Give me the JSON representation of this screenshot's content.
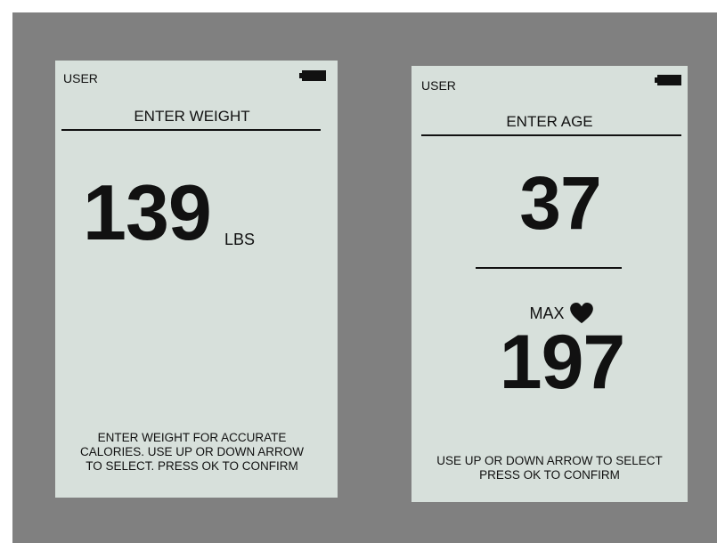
{
  "weight_screen": {
    "user": "USER",
    "title": "ENTER WEIGHT",
    "value": "139",
    "unit": "LBS",
    "instructions_line1": "ENTER WEIGHT FOR ACCURATE",
    "instructions_line2": "CALORIES.  USE UP OR DOWN ARROW",
    "instructions_line3": "TO SELECT. PRESS OK TO CONFIRM",
    "battery_icon": "battery-icon"
  },
  "age_screen": {
    "user": "USER",
    "title": "ENTER AGE",
    "value": "37",
    "max_label": "MAX",
    "heart_icon": "heart-icon",
    "max_value": "197",
    "instructions_line1": "USE UP OR DOWN ARROW TO SELECT",
    "instructions_line2": "PRESS OK TO CONFIRM",
    "battery_icon": "battery-icon"
  },
  "colors": {
    "screen_background": "#d7e0db",
    "backdrop": "#808080",
    "text": "#111111"
  }
}
